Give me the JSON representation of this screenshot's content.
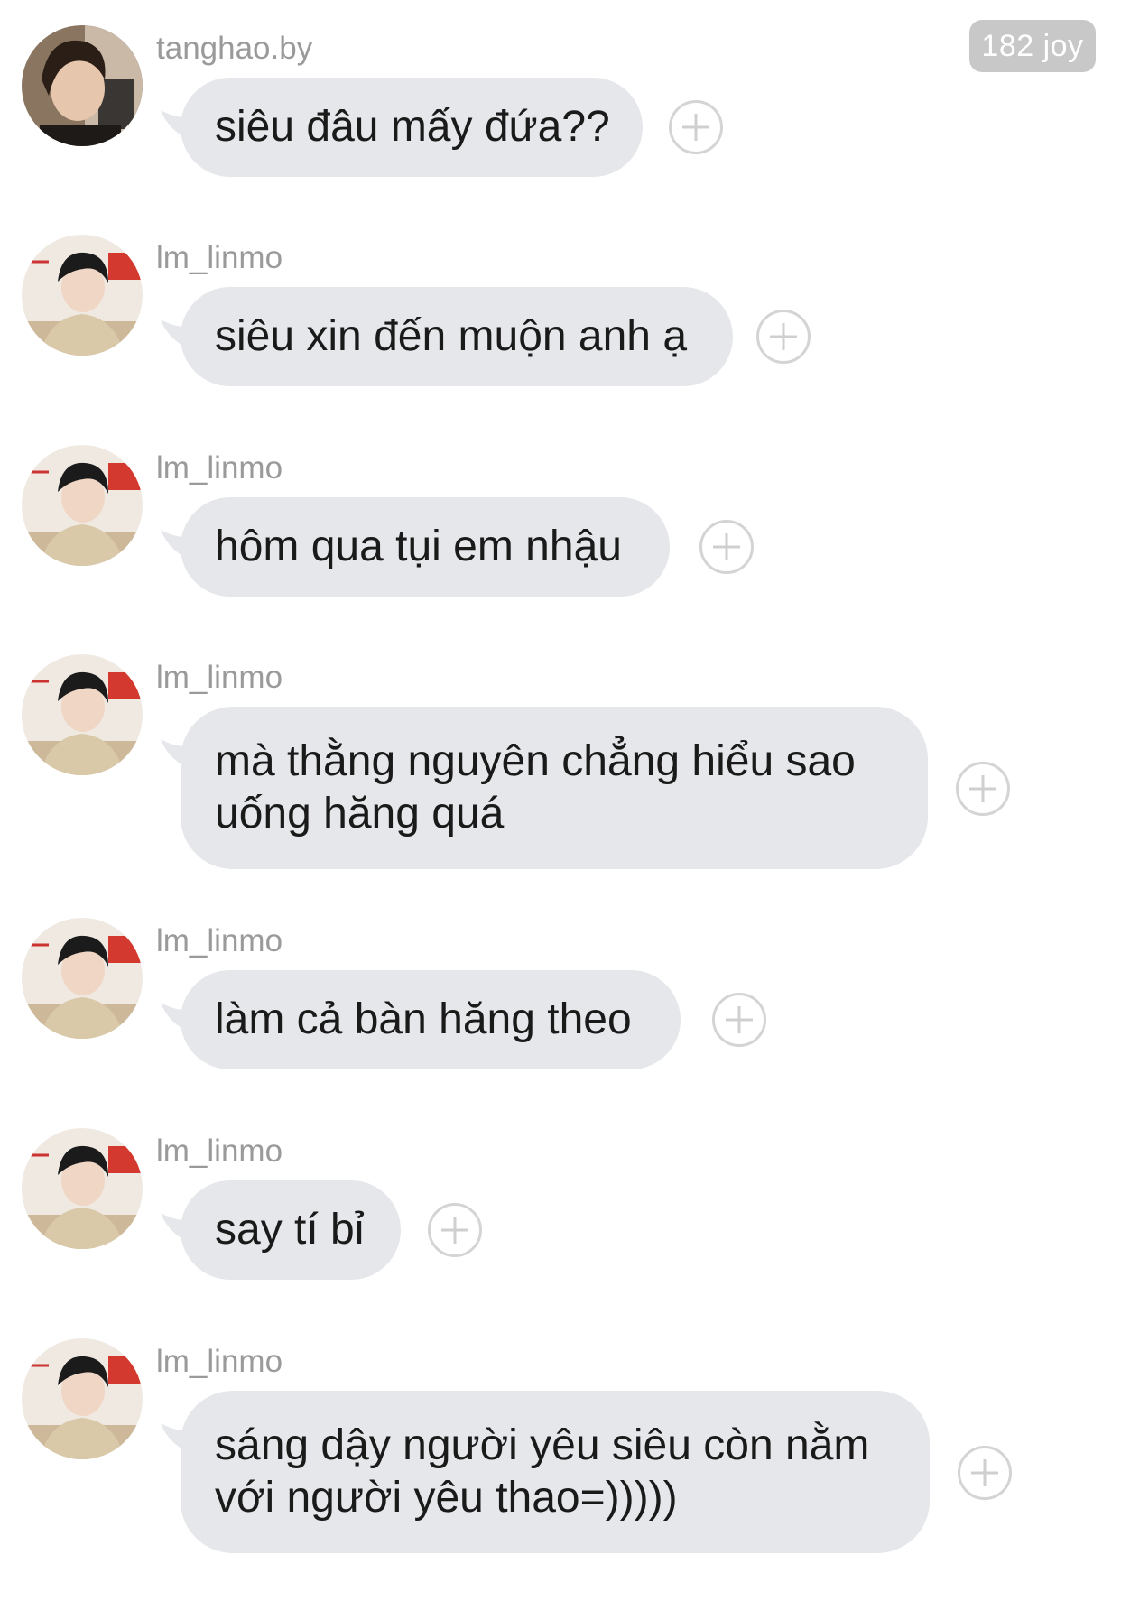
{
  "header": {
    "joy_badge": "182 joy"
  },
  "messages": [
    {
      "username": "tanghao.by",
      "text": "siêu đâu mấy đứa??",
      "avatar": "avatar-dark-hair"
    },
    {
      "username": "lm_linmo",
      "text": "siêu xin đến muộn anh ạ",
      "avatar": "avatar-event"
    },
    {
      "username": "lm_linmo",
      "text": "hôm qua tụi em nhậu",
      "avatar": "avatar-event"
    },
    {
      "username": "lm_linmo",
      "text": "mà thằng nguyên chẳng hiểu sao\nuống hăng quá",
      "avatar": "avatar-event"
    },
    {
      "username": "lm_linmo",
      "text": "làm cả bàn hăng theo",
      "avatar": "avatar-event"
    },
    {
      "username": "lm_linmo",
      "text": "say tí bỉ",
      "avatar": "avatar-event"
    },
    {
      "username": "lm_linmo",
      "text": "sáng dậy người yêu siêu còn nằm\nvới người yêu thao=)))))",
      "avatar": "avatar-event"
    }
  ],
  "icons": {
    "add_reaction": "plus-circle-icon"
  },
  "colors": {
    "bubble": "#e5e7ea",
    "username": "#9a9a9a",
    "badge": "#c8c8c8",
    "text": "#1a1a1a"
  }
}
